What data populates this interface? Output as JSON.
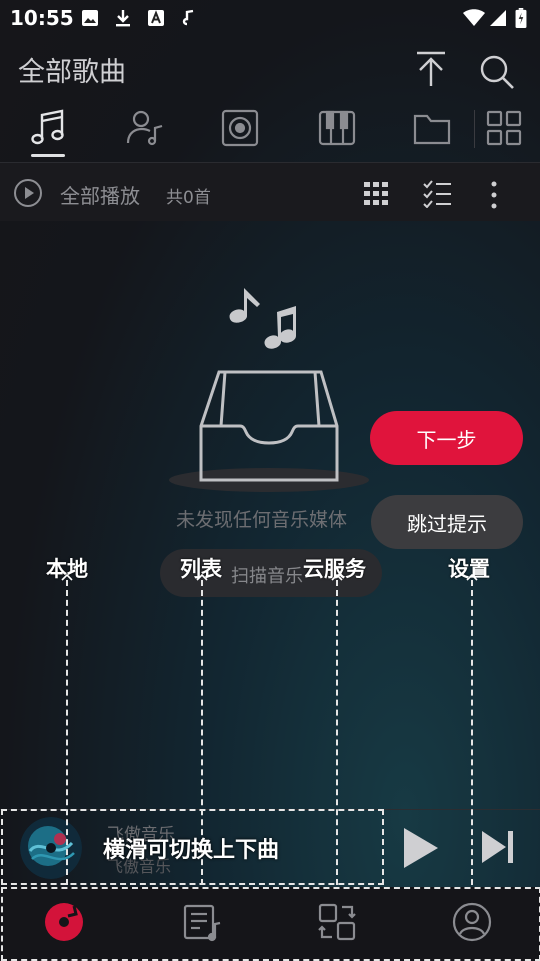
{
  "status_bar": {
    "time": "10:55",
    "left_icons": [
      "image-icon",
      "download-icon",
      "font-app-icon",
      "notification-icon"
    ],
    "right_icons": [
      "wifi-icon",
      "signal-icon",
      "battery-icon"
    ]
  },
  "header": {
    "title": "全部歌曲",
    "actions": [
      "upload-icon",
      "search-icon"
    ]
  },
  "tabs": [
    {
      "name": "songs",
      "icon": "music-note-icon",
      "active": true
    },
    {
      "name": "artists",
      "icon": "artist-icon",
      "active": false
    },
    {
      "name": "albums",
      "icon": "album-icon",
      "active": false
    },
    {
      "name": "genres",
      "icon": "piano-icon",
      "active": false
    },
    {
      "name": "folders",
      "icon": "folder-icon",
      "active": false
    },
    {
      "name": "more",
      "icon": "grid-icon",
      "active": false
    }
  ],
  "play_all": {
    "label": "全部播放",
    "count_text": "共0首"
  },
  "empty_state": {
    "message": "未发现任何音乐媒体",
    "scan_label": "扫描音乐"
  },
  "guide": {
    "next_label": "下一步",
    "skip_label": "跳过提示",
    "labels": [
      "本地",
      "列表",
      "云服务",
      "设置"
    ],
    "swipe_hint": "横滑可切换上下曲"
  },
  "mini_player": {
    "title": "飞傲音乐",
    "artist": "飞傲音乐"
  },
  "bottom_nav": [
    "local-disc-icon",
    "playlist-icon",
    "cloud-service-icon",
    "profile-icon"
  ],
  "colors": {
    "accent": "#e0143c",
    "background": "#16161a",
    "text_muted": "#8d8e93"
  }
}
